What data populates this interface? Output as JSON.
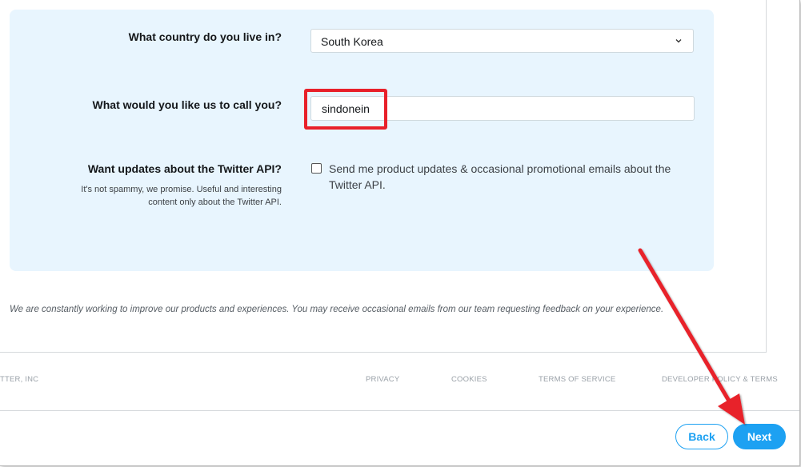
{
  "form": {
    "country": {
      "label": "What country do you live in?",
      "selected": "South Korea"
    },
    "nickname": {
      "label": "What would you like us to call you?",
      "value": "sindonein"
    },
    "updates": {
      "label": "Want updates about the Twitter API?",
      "sub_line1": "It's not spammy, we promise. Useful and interesting",
      "sub_line2": "content only about the Twitter API.",
      "checkbox_line1": "Send me product updates & occasional promotional emails about the",
      "checkbox_line2": "Twitter API.",
      "checked": false
    }
  },
  "footer": {
    "note": "We are constantly working to improve our products and experiences. You may receive occasional emails from our team requesting feedback on your experience."
  },
  "legal": {
    "company": "TTER, INC",
    "privacy": "PRIVACY",
    "cookies": "COOKIES",
    "terms": "TERMS OF SERVICE",
    "developer_policy": "DEVELOPER POLICY & TERMS"
  },
  "actions": {
    "back": "Back",
    "next": "Next"
  },
  "colors": {
    "accent": "#1da1f2",
    "panel": "#e8f5fe",
    "annotation": "#e8202a"
  },
  "icons": {
    "select_chevron": "chevron-down-icon",
    "annotation_arrow": "arrow-annotation"
  }
}
